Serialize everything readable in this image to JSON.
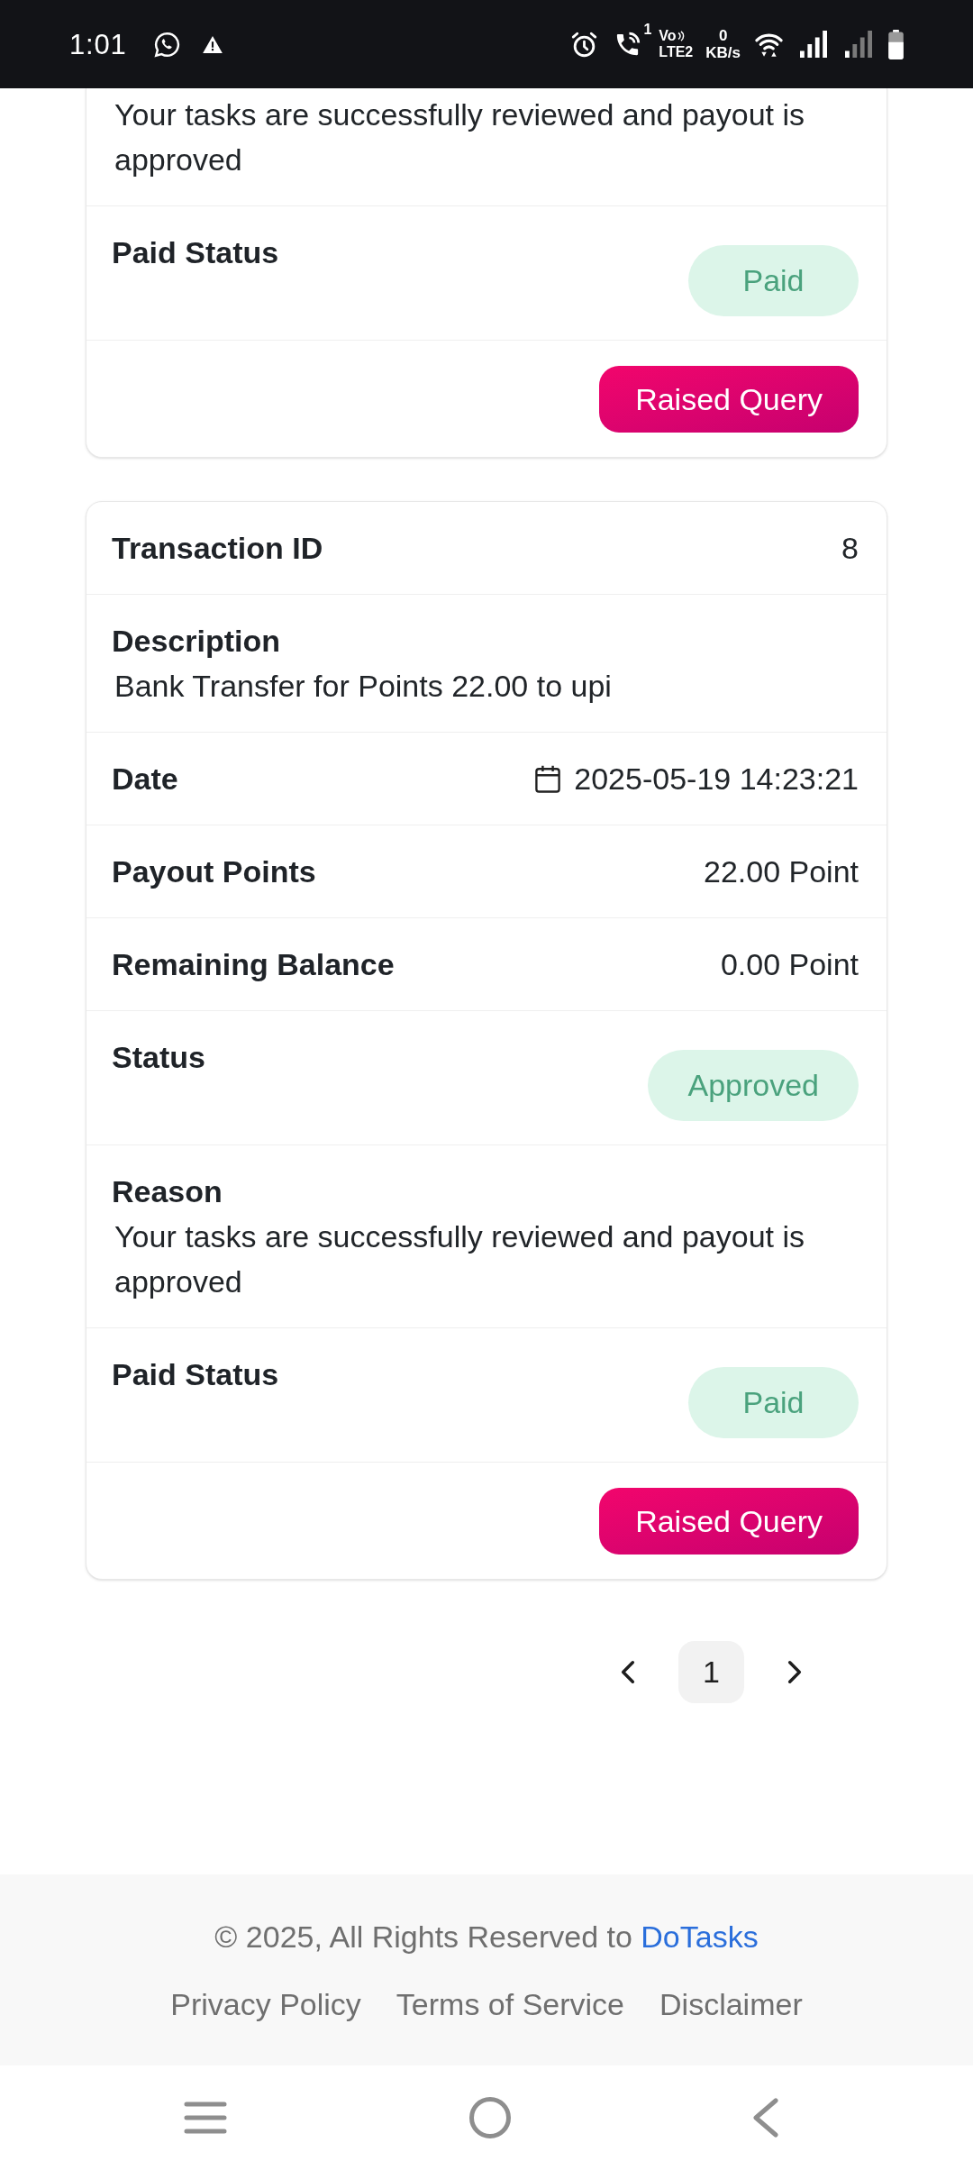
{
  "status_bar": {
    "time": "1:01",
    "call_count": "1",
    "network": {
      "top": "Vo",
      "bottom": "LTE2"
    },
    "data_speed": {
      "value": "0",
      "unit": "KB/s"
    }
  },
  "transactions": [
    {
      "cut_off_top": true,
      "rows": [
        {
          "kind": "text",
          "value": "Your tasks are successfully reviewed and payout is approved"
        },
        {
          "kind": "badge",
          "label": "Paid Status",
          "value": "Paid"
        }
      ],
      "action": "Raised Query"
    },
    {
      "cut_off_top": false,
      "rows": [
        {
          "kind": "pair",
          "label": "Transaction ID",
          "value": "8"
        },
        {
          "kind": "stacked",
          "label": "Description",
          "value": "Bank Transfer for Points 22.00 to upi"
        },
        {
          "kind": "date",
          "label": "Date",
          "value": "2025-05-19 14:23:21"
        },
        {
          "kind": "pair",
          "label": "Payout Points",
          "value": "22.00 Point"
        },
        {
          "kind": "pair",
          "label": "Remaining Balance",
          "value": "0.00 Point"
        },
        {
          "kind": "badge",
          "label": "Status",
          "value": "Approved"
        },
        {
          "kind": "stacked",
          "label": "Reason",
          "value": "Your tasks are successfully reviewed and payout is approved"
        },
        {
          "kind": "badge",
          "label": "Paid Status",
          "value": "Paid"
        }
      ],
      "action": "Raised Query"
    }
  ],
  "pagination": {
    "pages": [
      {
        "label": "1",
        "selected": true
      }
    ]
  },
  "footer": {
    "copyright": "© 2025, All Rights Reserved to",
    "brand_link": "DoTasks",
    "links": [
      "Privacy Policy",
      "Terms of Service",
      "Disclaimer"
    ]
  }
}
